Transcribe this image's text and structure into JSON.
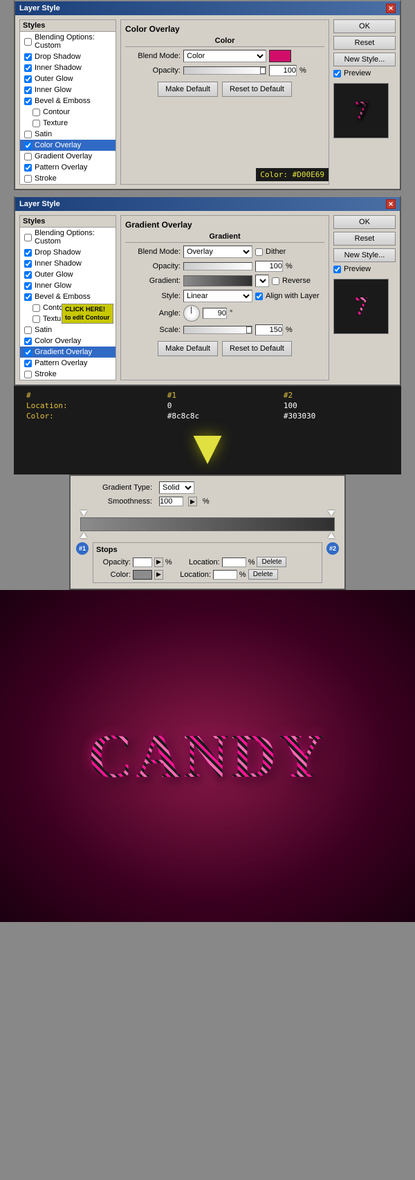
{
  "dialog1": {
    "title": "Layer Style",
    "tabs": {
      "styles_header": "Styles",
      "items": [
        {
          "label": "Blending Options: Custom",
          "checked": false,
          "active": false
        },
        {
          "label": "Drop Shadow",
          "checked": true,
          "active": false
        },
        {
          "label": "Inner Shadow",
          "checked": true,
          "active": false
        },
        {
          "label": "Outer Glow",
          "checked": true,
          "active": false
        },
        {
          "label": "Inner Glow",
          "checked": true,
          "active": false
        },
        {
          "label": "Bevel & Emboss",
          "checked": true,
          "active": false
        },
        {
          "label": "Contour",
          "checked": false,
          "active": false,
          "indent": true
        },
        {
          "label": "Texture",
          "checked": false,
          "active": false,
          "indent": true
        },
        {
          "label": "Satin",
          "checked": false,
          "active": false
        },
        {
          "label": "Color Overlay",
          "checked": true,
          "active": true
        },
        {
          "label": "Gradient Overlay",
          "checked": false,
          "active": false
        },
        {
          "label": "Pattern Overlay",
          "checked": true,
          "active": false
        },
        {
          "label": "Stroke",
          "checked": false,
          "active": false
        }
      ]
    },
    "section_title": "Color Overlay",
    "section_subtitle": "Color",
    "blend_mode_label": "Blend Mode:",
    "blend_mode_value": "Color",
    "opacity_label": "Opacity:",
    "opacity_value": "100",
    "opacity_pct": "%",
    "make_default": "Make Default",
    "reset_to_default": "Reset to Default",
    "buttons": {
      "ok": "OK",
      "reset": "Reset",
      "new_style": "New Style...",
      "preview_label": "Preview"
    },
    "preview_char": "7",
    "color_tooltip": "Color: #D00E69"
  },
  "dialog2": {
    "title": "Layer Style",
    "tabs": {
      "styles_header": "Styles",
      "items": [
        {
          "label": "Blending Options: Custom",
          "checked": false,
          "active": false
        },
        {
          "label": "Drop Shadow",
          "checked": true,
          "active": false
        },
        {
          "label": "Inner Shadow",
          "checked": true,
          "active": false
        },
        {
          "label": "Outer Glow",
          "checked": true,
          "active": false
        },
        {
          "label": "Inner Glow",
          "checked": true,
          "active": false
        },
        {
          "label": "Bevel & Emboss",
          "checked": true,
          "active": false
        },
        {
          "label": "Contour",
          "checked": false,
          "active": false,
          "indent": true
        },
        {
          "label": "Texture",
          "checked": false,
          "active": false,
          "indent": true
        },
        {
          "label": "Satin",
          "checked": false,
          "active": false
        },
        {
          "label": "Color Overlay",
          "checked": true,
          "active": false
        },
        {
          "label": "Gradient Overlay",
          "checked": true,
          "active": true
        },
        {
          "label": "Pattern Overlay",
          "checked": true,
          "active": false
        },
        {
          "label": "Stroke",
          "checked": false,
          "active": false
        }
      ]
    },
    "section_title": "Gradient Overlay",
    "section_subtitle": "Gradient",
    "blend_mode_label": "Blend Mode:",
    "blend_mode_value": "Overlay",
    "opacity_label": "Opacity:",
    "opacity_value": "100",
    "dither_label": "Dither",
    "gradient_label": "Gradient:",
    "reverse_label": "Reverse",
    "style_label": "Style:",
    "style_value": "Linear",
    "align_label": "Align with Layer",
    "angle_label": "Angle:",
    "angle_value": "90",
    "angle_symbol": "°",
    "scale_label": "Scale:",
    "scale_value": "150",
    "scale_pct": "%",
    "opacity_pct": "%",
    "make_default": "Make Default",
    "reset_to_default": "Reset to Default",
    "buttons": {
      "ok": "OK",
      "reset": "Reset",
      "new_style": "New Style...",
      "preview_label": "Preview"
    },
    "preview_char": "7",
    "click_tooltip_line1": "CLICK HERE!",
    "click_tooltip_line2": "to edit Contour"
  },
  "annotation": {
    "col_hash": "#",
    "col_1": "#1",
    "col_2": "#2",
    "row_location": "Location:",
    "loc_1": "0",
    "loc_2": "100",
    "row_color": "Color:",
    "color_1": "#8c8c8c",
    "color_2": "#303030"
  },
  "gradient_editor": {
    "type_label": "Gradient Type:",
    "type_value": "Solid",
    "smoothness_label": "Smoothness:",
    "smoothness_value": "100",
    "smoothness_pct": "%",
    "stops_header": "Stops",
    "stop1_label": "#1",
    "stop2_label": "#2",
    "opacity_row": {
      "label": "Opacity:",
      "value": "",
      "pct": "%",
      "location_label": "Location:",
      "location_value": "",
      "location_pct": "%",
      "delete_btn": "Delete"
    },
    "color_row": {
      "label": "Color:",
      "location_label": "Location:",
      "location_value": "",
      "location_pct": "%",
      "delete_btn": "Delete"
    }
  },
  "canvas": {
    "text": "CANDY"
  }
}
